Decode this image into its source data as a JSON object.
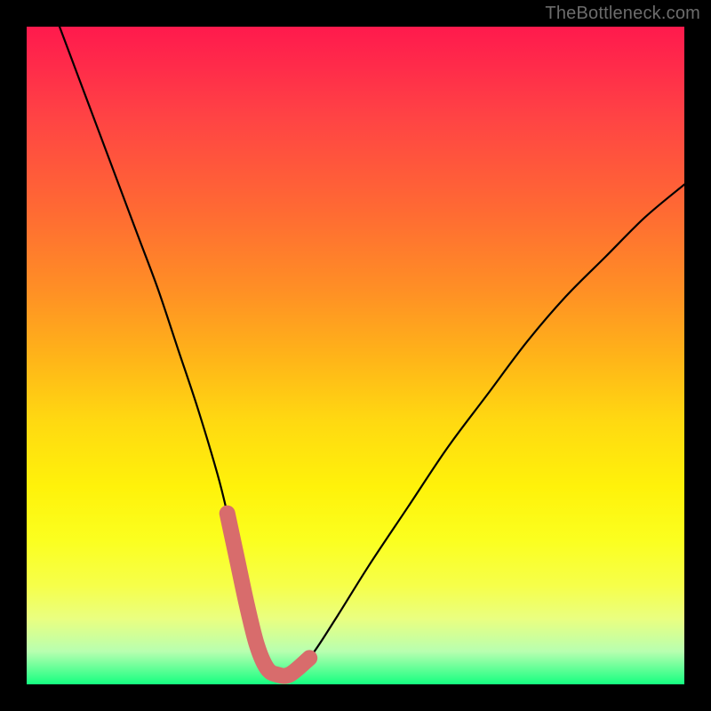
{
  "watermark": "TheBottleneck.com",
  "chart_data": {
    "type": "line",
    "title": "",
    "xlabel": "",
    "ylabel": "",
    "xlim": [
      0,
      100
    ],
    "ylim": [
      0,
      100
    ],
    "series": [
      {
        "name": "bottleneck-curve",
        "x": [
          5,
          8,
          11,
          14,
          17,
          20,
          23,
          26,
          29,
          30.5,
          32,
          33.5,
          35,
          36.5,
          38,
          40,
          43,
          47,
          52,
          58,
          64,
          70,
          76,
          82,
          88,
          94,
          100
        ],
        "values": [
          100,
          92,
          84,
          76,
          68,
          60,
          51,
          42,
          32,
          26,
          19,
          12,
          6,
          2.5,
          1.5,
          1.5,
          4,
          10,
          18,
          27,
          36,
          44,
          52,
          59,
          65,
          71,
          76
        ]
      }
    ],
    "highlight": {
      "name": "bottleneck-trough",
      "color": "#d86c6c",
      "x": [
        30.5,
        32,
        33.5,
        35,
        36.5,
        38,
        40,
        43
      ],
      "values": [
        26,
        19,
        12,
        6,
        2.5,
        1.5,
        1.5,
        4
      ]
    },
    "background_gradient": {
      "top": "#ff1a4d",
      "mid": "#fff20a",
      "bottom": "#15ff80"
    }
  }
}
